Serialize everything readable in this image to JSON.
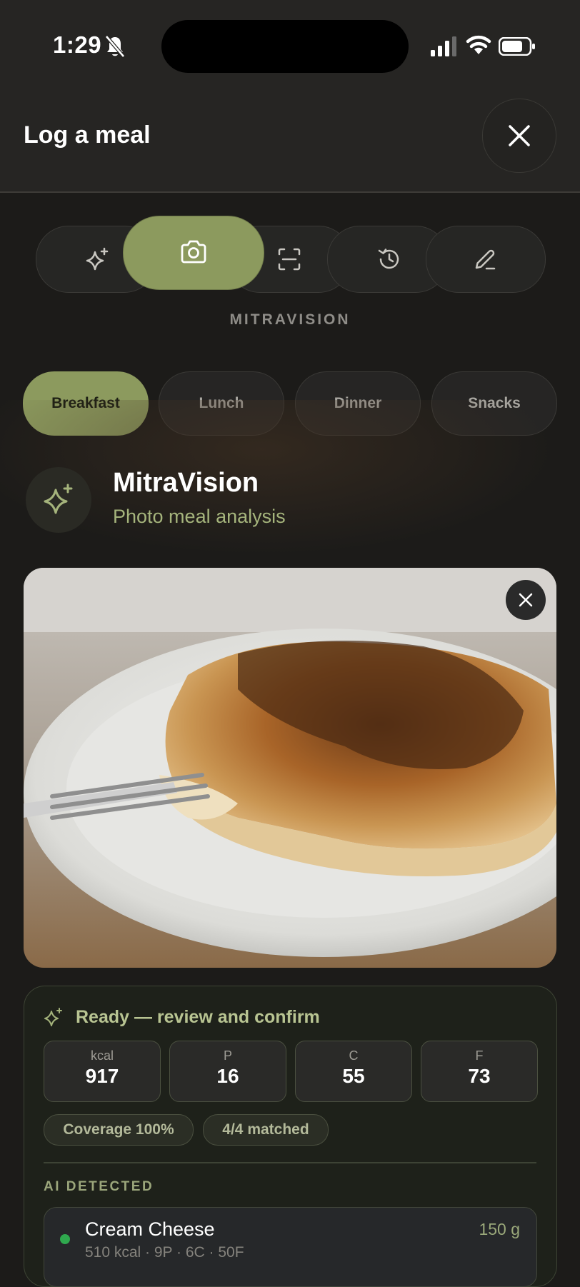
{
  "status": {
    "time": "1:29"
  },
  "header": {
    "title": "Log a meal"
  },
  "modes": [
    {
      "icon": "sparkle-icon"
    },
    {
      "icon": "camera-icon",
      "active": true
    },
    {
      "icon": "scan-icon"
    },
    {
      "icon": "history-icon"
    },
    {
      "icon": "pencil-icon"
    }
  ],
  "mode_label": "MITRAVISION",
  "meal_tabs": [
    "Breakfast",
    "Lunch",
    "Dinner",
    "Snacks"
  ],
  "active_tab": "Breakfast",
  "vision": {
    "title": "MitraVision",
    "subtitle": "Photo meal analysis"
  },
  "result": {
    "status": "Ready — review and confirm",
    "macros": [
      {
        "label": "kcal",
        "value": "917"
      },
      {
        "label": "P",
        "value": "16"
      },
      {
        "label": "C",
        "value": "55"
      },
      {
        "label": "F",
        "value": "73"
      }
    ],
    "chips": [
      "Coverage 100%",
      "4/4 matched"
    ],
    "section_label": "AI DETECTED",
    "items": [
      {
        "name": "Cream Cheese",
        "weight": "150 g",
        "meta": "510 kcal · 9P · 6C · 50F"
      }
    ]
  },
  "colors": {
    "accent": "#8c9a5e",
    "accent_text": "#a5b47c",
    "background": "#1c1b19"
  }
}
